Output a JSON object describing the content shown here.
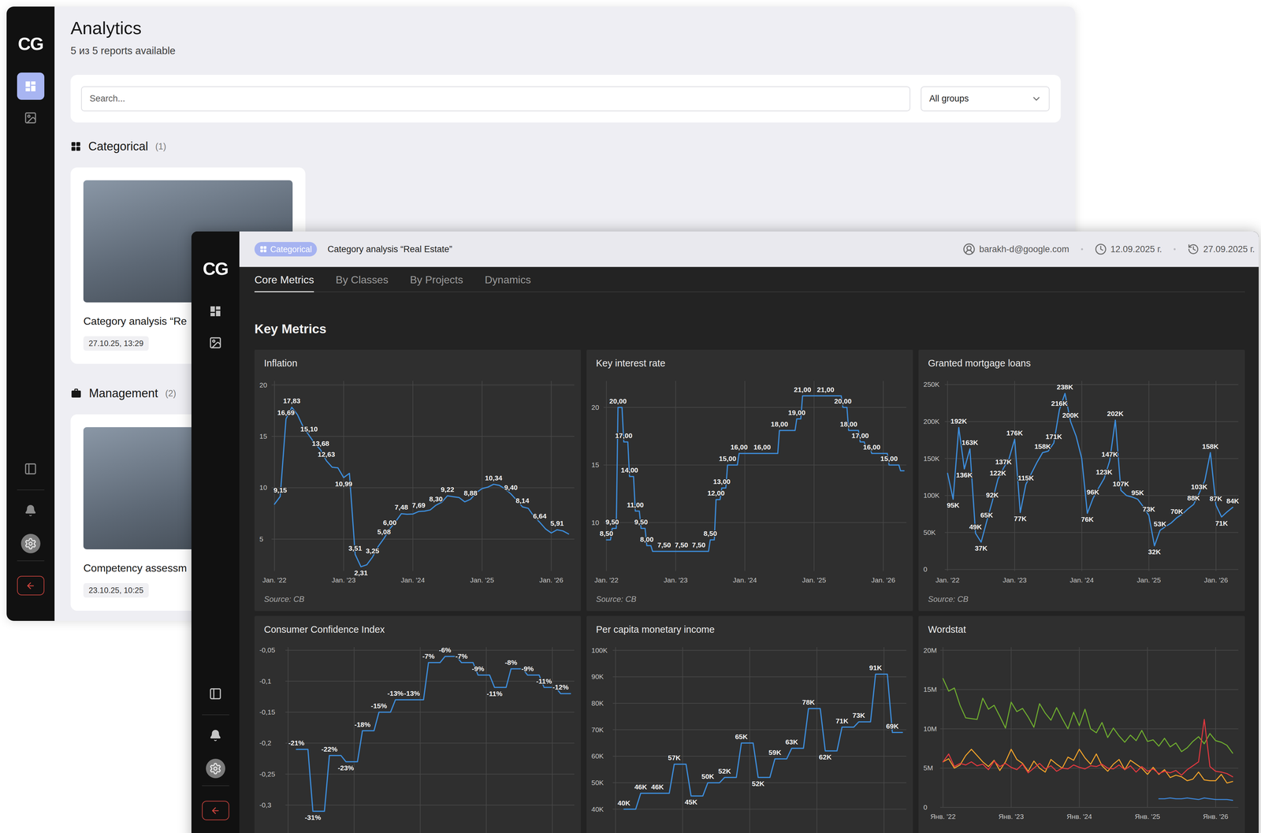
{
  "analytics_window": {
    "sidebar": {
      "logo": "CG",
      "nav": [
        {
          "selected": true
        },
        {
          "selected": false
        }
      ]
    },
    "title": "Analytics",
    "subtitle": "5 из 5 reports available",
    "search": {
      "placeholder": "Search..."
    },
    "group_filter": {
      "value": "All groups"
    },
    "sections": [
      {
        "title": "Categorical",
        "count": "(1)",
        "cards": [
          {
            "title": "Category analysis “Re",
            "date": "27.10.25, 13:29"
          }
        ]
      },
      {
        "title": "Management",
        "count": "(2)",
        "cards": [
          {
            "title": "Competency assessm",
            "date": "23.10.25, 10:25"
          }
        ]
      }
    ]
  },
  "report_window": {
    "sidebar": {
      "logo": "CG",
      "nav": [
        {
          "selected": false
        },
        {
          "selected": false
        }
      ]
    },
    "header": {
      "badge": "Categorical",
      "title": "Category analysis “Real Estate”",
      "user": "barakh-d@google.com",
      "created": "12.09.2025 г.",
      "updated": "27.09.2025 г."
    },
    "tabs": [
      {
        "label": "Core Metrics",
        "selected": true
      },
      {
        "label": "By Classes",
        "selected": false
      },
      {
        "label": "By Projects",
        "selected": false
      },
      {
        "label": "Dynamics",
        "selected": false
      }
    ],
    "section_title": "Key Metrics",
    "charts": [
      {
        "title": "Inflation",
        "kind": "line",
        "period": "month",
        "domain": [
          1.9,
          20.4
        ],
        "y_ticks": [
          {
            "value": 20,
            "label": "20"
          },
          {
            "value": 15,
            "label": "15"
          },
          {
            "value": 10,
            "label": "10"
          },
          {
            "value": 5,
            "label": "5"
          }
        ],
        "x_labels": [
          "Jan. '22",
          "Jan. '23",
          "Jan. '24",
          "Jan. '25",
          "Jan. '26"
        ],
        "source": "Source: CB",
        "series": [
          {
            "color": "#3d8ddb",
            "values": [
              8.4,
              9.15,
              16.69,
              17.83,
              17.1,
              15.9,
              15.1,
              14.3,
              13.68,
              12.63,
              12.0,
              11.94,
              10.99,
              11.4,
              3.51,
              2.31,
              2.5,
              3.25,
              4.3,
              5.08,
              6.0,
              6.7,
              7.48,
              7.42,
              7.44,
              7.69,
              7.72,
              7.84,
              8.3,
              8.59,
              9.22,
              9.13,
              9.05,
              8.63,
              8.88,
              9.52,
              9.92,
              10.06,
              10.34,
              10.23,
              9.88,
              9.4,
              8.79,
              8.14,
              8.0,
              7.2,
              6.64,
              6.0,
              5.6,
              5.91,
              5.8,
              5.5
            ],
            "labels": [
              "",
              "9,15",
              "16,69",
              "17,83",
              "",
              "",
              "15,10",
              "",
              "13,68",
              "12,63",
              "",
              "",
              "10,99",
              "",
              "3,51",
              "2,31",
              "",
              "3,25",
              "",
              "5,08",
              "6,00",
              "",
              "7,48",
              "",
              "",
              "7,69",
              "",
              "",
              "8,30",
              "",
              "9,22",
              "",
              "",
              "",
              "8,88",
              "",
              "",
              "",
              "10,34",
              "",
              "",
              "9,40",
              "",
              "8,14",
              "",
              "",
              "6,64",
              "",
              "",
              "5,91",
              "",
              ""
            ]
          }
        ]
      },
      {
        "title": "Key interest rate",
        "kind": "step",
        "period": "month",
        "domain": [
          5.8,
          22.3
        ],
        "y_ticks": [
          {
            "value": 20,
            "label": "20"
          },
          {
            "value": 15,
            "label": "15"
          },
          {
            "value": 10,
            "label": "10"
          }
        ],
        "x_labels": [
          "Jan. '22",
          "Jan. '23",
          "Jan. '24",
          "Jan. '25",
          "Jan. '26"
        ],
        "source": "Source: CB",
        "series": [
          {
            "color": "#3d8ddb",
            "values": [
              8.5,
              9.5,
              20,
              17,
              14,
              11,
              9.5,
              8,
              7.5,
              7.5,
              7.5,
              7.5,
              7.5,
              7.5,
              7.5,
              7.5,
              7.5,
              7.5,
              8.5,
              12,
              13,
              15,
              15,
              16,
              16,
              16,
              16,
              16,
              16,
              16,
              18,
              18,
              18,
              19,
              21,
              21,
              21,
              21,
              21,
              21,
              21,
              20,
              18,
              18,
              17,
              16.5,
              16,
              16,
              16,
              15,
              15,
              14.5
            ],
            "labels": [
              "8,50",
              "9,50",
              "20,00",
              "17,00",
              "14,00",
              "11,00",
              "9,50",
              "8,00",
              "",
              "",
              "7,50",
              "",
              "",
              "7,50",
              "",
              "",
              "7,50",
              "",
              "8,50",
              "12,00",
              "13,00",
              "15,00",
              "",
              "16,00",
              "",
              "",
              "",
              "16,00",
              "",
              "",
              "18,00",
              "",
              "",
              "19,00",
              "21,00",
              "",
              "",
              "",
              "21,00",
              "",
              "",
              "20,00",
              "18,00",
              "",
              "17,00",
              "",
              "16,00",
              "",
              "",
              "15,00",
              "",
              ""
            ]
          }
        ]
      },
      {
        "title": "Granted mortgage loans",
        "kind": "line",
        "period": "month",
        "domain": [
          -2,
          255
        ],
        "y_ticks": [
          {
            "value": 250,
            "label": "250K"
          },
          {
            "value": 200,
            "label": "200K"
          },
          {
            "value": 150,
            "label": "150K"
          },
          {
            "value": 100,
            "label": "100K"
          },
          {
            "value": 50,
            "label": "50K"
          },
          {
            "value": 0,
            "label": "0"
          }
        ],
        "x_labels": [
          "Jan. '22",
          "Jan. '23",
          "Jan. '24",
          "Jan. '25",
          "Jan. '26"
        ],
        "source": "Source: CB",
        "series": [
          {
            "color": "#3d8ddb",
            "values": [
              130,
              95,
              192,
              136,
              163,
              49,
              37,
              65,
              92,
              122,
              137,
              150,
              176,
              77,
              115,
              130,
              145,
              158,
              160,
              171,
              216,
              238,
              200,
              180,
              150,
              76,
              96,
              110,
              123,
              147,
              202,
              107,
              100,
              98,
              95,
              85,
              73,
              32,
              53,
              58,
              63,
              70,
              75,
              82,
              88,
              103,
              120,
              158,
              87,
              71,
              78,
              84
            ],
            "labels": [
              "",
              "95K",
              "192K",
              "136K",
              "163K",
              "49K",
              "37K",
              "65K",
              "92K",
              "122K",
              "137K",
              "",
              "176K",
              "77K",
              "115K",
              "",
              "",
              "158K",
              "",
              "171K",
              "216K",
              "238K",
              "200K",
              "",
              "",
              "76K",
              "96K",
              "",
              "123K",
              "147K",
              "202K",
              "107K",
              "",
              "",
              "95K",
              "",
              "73K",
              "32K",
              "53K",
              "",
              "",
              "70K",
              "",
              "",
              "88K",
              "103K",
              "",
              "158K",
              "87K",
              "71K",
              "",
              "84K"
            ]
          }
        ]
      },
      {
        "title": "Consumer Confidence Index",
        "kind": "step",
        "period": "quarter",
        "domain": [
          -0.352,
          -0.045
        ],
        "y_ticks": [
          {
            "value": -0.05,
            "label": "-0,05"
          },
          {
            "value": -0.1,
            "label": "-0,1"
          },
          {
            "value": -0.15,
            "label": "-0,15"
          },
          {
            "value": -0.2,
            "label": "-0,2"
          },
          {
            "value": -0.25,
            "label": "-0,25"
          },
          {
            "value": -0.3,
            "label": "-0,3"
          }
        ],
        "series": [
          {
            "color": "#3d8ddb",
            "values": [
              -0.21,
              -0.31,
              -0.22,
              -0.23,
              -0.18,
              -0.15,
              -0.13,
              -0.13,
              -0.07,
              -0.06,
              -0.07,
              -0.09,
              -0.11,
              -0.08,
              -0.09,
              -0.11,
              -0.12
            ],
            "labels": [
              "-21%",
              "-31%",
              "-22%",
              "-23%",
              "-18%",
              "-15%",
              "-13%",
              "-13%",
              "-7%",
              "-6%",
              "-7%",
              "-9%",
              "-11%",
              "-8%",
              "-9%",
              "-11%",
              "-12%"
            ]
          }
        ]
      },
      {
        "title": "Per capita monetary income",
        "kind": "step",
        "period": "quarter",
        "domain": [
          29.4,
          101.2
        ],
        "y_ticks": [
          {
            "value": 100,
            "label": "100K"
          },
          {
            "value": 90,
            "label": "90K"
          },
          {
            "value": 80,
            "label": "80K"
          },
          {
            "value": 70,
            "label": "70K"
          },
          {
            "value": 60,
            "label": "60K"
          },
          {
            "value": 50,
            "label": "50K"
          },
          {
            "value": 40,
            "label": "40K"
          }
        ],
        "series": [
          {
            "color": "#3d8ddb",
            "values": [
              40,
              46,
              46,
              57,
              45,
              50,
              52,
              65,
              52,
              59,
              63,
              78,
              62,
              71,
              73,
              91,
              69
            ],
            "labels": [
              "40K",
              "46K",
              "46K",
              "57K",
              "45K",
              "50K",
              "52K",
              "65K",
              "52K",
              "59K",
              "63K",
              "78K",
              "62K",
              "71K",
              "73K",
              "91K",
              "69K"
            ]
          }
        ]
      },
      {
        "title": "Wordstat",
        "kind": "multi",
        "period": "month",
        "domain": [
          0,
          20.4
        ],
        "y_ticks": [
          {
            "value": 20,
            "label": "20M"
          },
          {
            "value": 15,
            "label": "15M"
          },
          {
            "value": 10,
            "label": "10M"
          },
          {
            "value": 5,
            "label": "5M"
          },
          {
            "value": 0,
            "label": "0"
          }
        ],
        "x_labels": [
          "Янв. '22",
          "Янв. '23",
          "Янв. '24",
          "Янв. '25",
          "Янв. '26"
        ],
        "series": [
          {
            "color": "#6fae2f",
            "values": [
              16.4,
              14.8,
              15.2,
              13.0,
              11.4,
              11.3,
              11.2,
              13.9,
              12.5,
              13.0,
              11.6,
              10.1,
              13.4,
              12.2,
              12.6,
              11.5,
              10.2,
              13.2,
              12.0,
              11.1,
              12.7,
              11.3,
              10.0,
              12.1,
              10.4,
              12.5,
              10.0,
              9.5,
              10.8,
              8.9,
              10.1,
              9.1,
              8.3,
              9.2,
              8.5,
              9.8,
              8.4,
              8.6,
              7.8,
              8.8,
              7.7,
              8.2,
              7.1,
              7.6,
              8.4,
              9.0,
              8.1,
              9.4,
              8.5,
              8.3,
              7.9,
              6.9
            ]
          },
          {
            "color": "#f0a22a",
            "values": [
              5.8,
              6.2,
              5.0,
              5.4,
              6.6,
              7.4,
              6.6,
              5.8,
              5.2,
              6.0,
              4.7,
              5.8,
              7.4,
              6.1,
              5.6,
              4.6,
              5.9,
              5.0,
              4.5,
              6.1,
              5.5,
              5.0,
              6.4,
              6.0,
              7.4,
              6.3,
              5.5,
              6.8,
              5.3,
              4.6,
              5.5,
              6.1,
              4.8,
              6.0,
              5.5,
              5.0,
              4.2,
              5.1,
              4.2,
              4.8,
              3.8,
              4.1,
              3.9,
              3.4,
              3.6,
              4.5,
              3.5,
              3.4,
              3.4,
              4.2,
              3.1,
              3.3
            ]
          },
          {
            "color": "#e2383f",
            "values": [
              5.8,
              6.8,
              5.2,
              5.6,
              5.4,
              5.8,
              5.3,
              5.5,
              4.8,
              5.9,
              5.2,
              5.6,
              5.1,
              4.8,
              5.5,
              4.4,
              5.0,
              5.6,
              4.9,
              5.3,
              4.6,
              5.0,
              4.9,
              5.4,
              5.1,
              4.9,
              5.3,
              5.2,
              5.5,
              5.0,
              4.9,
              5.4,
              4.8,
              5.3,
              4.5,
              5.2,
              4.6,
              4.9,
              4.3,
              4.6,
              4.4,
              4.7,
              4.1,
              4.8,
              5.3,
              5.8,
              11.2,
              5.2,
              4.6,
              4.5,
              4.3,
              3.9
            ]
          },
          {
            "color": "#3d86d8",
            "start": 38,
            "values": [
              1.1,
              1.1,
              1.2,
              1.1,
              1.1,
              1.2,
              1.1,
              1.0,
              1.2,
              1.1,
              1.0,
              1.0,
              1.0,
              0.9
            ]
          }
        ]
      }
    ]
  }
}
